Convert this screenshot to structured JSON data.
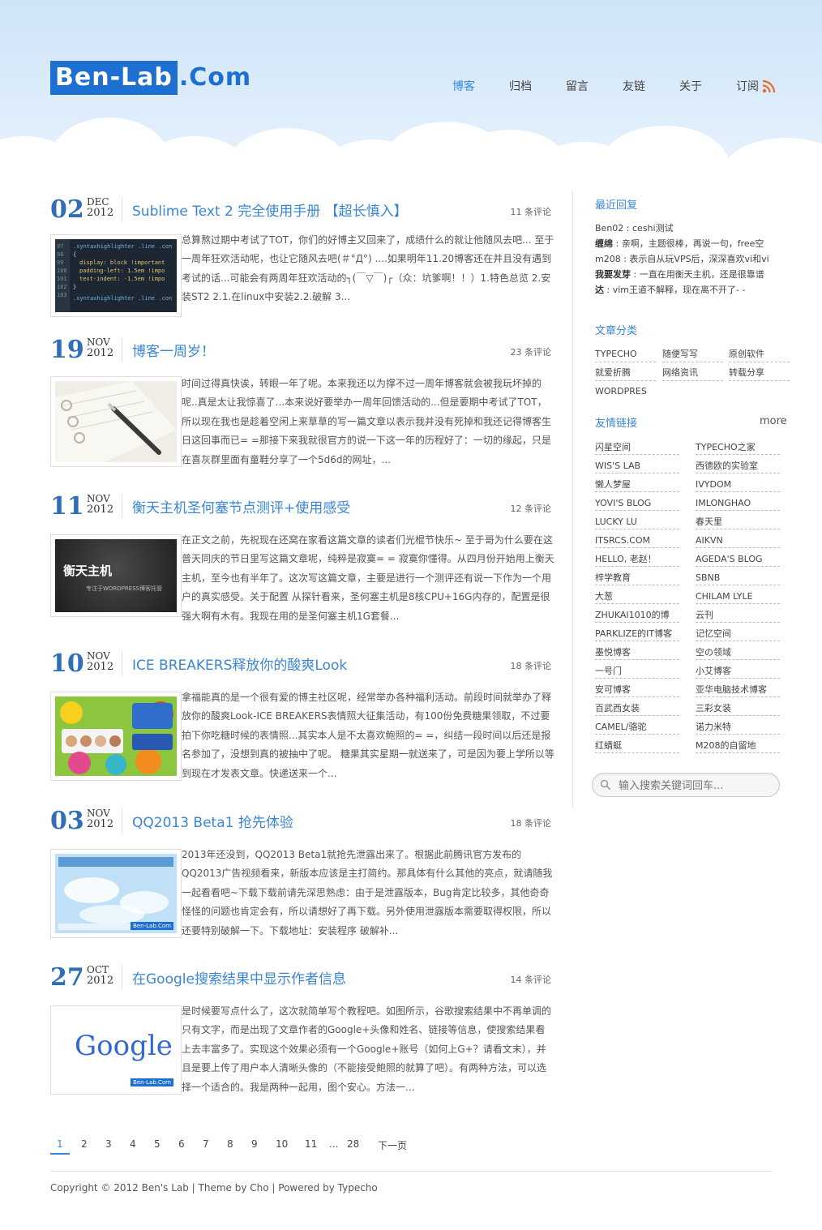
{
  "site": {
    "logo_boxed": "Ben-Lab",
    "logo_rest": ".Com"
  },
  "nav": [
    {
      "label": "博客",
      "active": true
    },
    {
      "label": "归档"
    },
    {
      "label": "留言"
    },
    {
      "label": "友链"
    },
    {
      "label": "关于"
    },
    {
      "label": "订阅"
    }
  ],
  "posts": [
    {
      "day": "02",
      "month": "DEC",
      "year": "2012",
      "title": "Sublime Text 2 完全使用手册 【超长慎入】",
      "comments": "11 条评论",
      "excerpt": "总算熬过期中考试了TOT，你们的好博主又回来了，成绩什么的就让他随风去吧... 至于一周年狂欢活动呢，也让它随风去吧(＃°Д°) ....如果明年11.20博客还在并且没有遇到考试的话...可能会有两周年狂欢活动的┐(￣▽￣)┌（众：坑爹啊！！）1.特色总览 2.安装ST2 2.1.在linux中安装2.2.破解 3...",
      "thumb": "code"
    },
    {
      "day": "19",
      "month": "NOV",
      "year": "2012",
      "title": "博客一周岁！",
      "comments": "23 条评论",
      "excerpt": "时间过得真快诶，转眼一年了呢。本来我还以为撑不过一周年博客就会被我玩坏掉的呢..真是太让我惊喜了...本来说好要举办一周年回馈活动的...但是要期中考试了TOT，所以现在我也是趁着空闲上来草草的写一篇文章以表示我并没有死掉和我还记得博客生日这回事而已= =那接下来我就很官方的说一下这一年的历程好了：一切的缘起，只是在喜灰群里面有童鞋分享了一个5d6d的网址，...",
      "thumb": "notebook"
    },
    {
      "day": "11",
      "month": "NOV",
      "year": "2012",
      "title": "衡天主机圣何塞节点测评+使用感受",
      "comments": "12 条评论",
      "excerpt": "在正文之前，先祝现在还窝在家看这篇文章的读者们光棍节快乐~ 至于哥为什么要在这普天同庆的节日里写这篇文章呢，纯粹是寂寞= = 寂寞你懂得。从四月份开始用上衡天主机，至今也有半年了。这次写这篇文章，主要是进行一个测评还有说一下作为一个用户的真实感受。关于配置 从探针看来，圣何塞主机是8核CPU+16G内存的，配置是很强大啊有木有。我现在用的是圣何塞主机1G套餐...",
      "thumb": "host",
      "thumb_title": "衡天主机",
      "thumb_sub": "专注于WORDPRESS博客托管"
    },
    {
      "day": "10",
      "month": "NOV",
      "year": "2012",
      "title": "ICE BREAKERS释放你的酸爽Look",
      "comments": "18 条评论",
      "excerpt": "拿福能真的是一个很有爱的博主社区呢，经常举办各种福利活动。前段时间就举办了释放你的酸爽Look-ICE BREAKERS表情照大征集活动，有100份免费糖果领取，不过要拍下你吃糖时候的表情照...其实本人是不太喜欢鲍照的= =，纠结一段时间以后还是报名参加了，没想到真的被抽中了呢。 糖果其实星期一就送来了，可是因为要上学所以等到现在才发表文章。快递送来一个...",
      "thumb": "candy"
    },
    {
      "day": "03",
      "month": "NOV",
      "year": "2012",
      "title": "QQ2013 Beta1 抢先体验",
      "comments": "18 条评论",
      "excerpt": "2013年还没到，QQ2013 Beta1就抢先泄露出来了。根据此前腾讯官方发布的QQ2013广告视频看来，新版本应该是主打简约。那具体有什么其他的亮点，就请随我一起看看吧~下载下载前请先深思熟虑：由于是泄露版本，Bug肯定比较多，其他奇奇怪怪的问题也肯定会有，所以请想好了再下载。另外使用泄露版本需要取得权限，所以还要特别破解一下。下载地址：安装程序 破解补...",
      "thumb": "qq",
      "thumb_badge": "Ben-Lab.Com"
    },
    {
      "day": "27",
      "month": "OCT",
      "year": "2012",
      "title": "在Google搜索结果中显示作者信息",
      "comments": "14 条评论",
      "excerpt": "是时候要写点什么了，这次就简单写个教程吧。如图所示，谷歌搜索结果中不再单调的只有文字，而是出现了文章作者的Google+头像和姓名、链接等信息，使搜索结果看上去丰富多了。实现这个效果必须有一个Google+账号（如何上G+？请看文末），并且是要上传了用户本人清晰头像的（不能接受鲍照的就算了吧）。有两种方法，可以选择一个适合的。我是两种一起用，图个安心。方法一...",
      "thumb": "google",
      "thumb_word": "Google",
      "thumb_badge": "Ben-Lab.Com"
    }
  ],
  "sidebar": {
    "recent_title": "最近回复",
    "recent": [
      {
        "author": "Ben02",
        "text": "ceshi测试"
      },
      {
        "author": "缠绵",
        "text": "亲啊，主题很棒，再说一句，free空"
      },
      {
        "author": "m208",
        "text": "表示自从玩VPS后，深深喜欢vi和vi"
      },
      {
        "author": "我要发芽",
        "text": "一直在用衡天主机，还是很靠谱"
      },
      {
        "author": "达",
        "text": "vim王道不解释，现在离不开了- -"
      }
    ],
    "cat_title": "文章分类",
    "categories": [
      "TYPECHO",
      "随便写写",
      "原创软件",
      "就爱折腾",
      "网络资讯",
      "转载分享",
      "WORDPRES"
    ],
    "links_title": "友情链接",
    "more": "more",
    "links_left": [
      "闪星空间",
      "WIS'S LAB",
      "懒人梦屋",
      "YOVI'S BLOG",
      "LUCKY LU",
      "ITSRCS.COM",
      "HELLO, 老赵！",
      "梓学教育",
      "大葱",
      "ZHUKAI1010的博",
      "PARKLIZE的IT博客",
      "墨悦博客",
      "一号门",
      "安可博客",
      "百武西女装",
      "CAMEL/骆驼",
      "红蜻蜓"
    ],
    "links_right": [
      "TYPECHO之家",
      "西德欧的实验室",
      "IVYDOM",
      "IMLONGHAO",
      "春天里",
      "AIKVN",
      "AGEDA'S BLOG",
      "SBNB",
      "CHILAM LYLE",
      "云刊",
      "记忆空间",
      "空の领域",
      "小艾博客",
      "亚华电脑技术博客",
      "三彩女装",
      "诺力米特",
      "M208的自留地"
    ],
    "search_placeholder": "输入搜索关键词回车..."
  },
  "pager": {
    "pages": [
      "1",
      "2",
      "3",
      "4",
      "5",
      "6",
      "7",
      "8",
      "9",
      "10",
      "11",
      "...",
      "28"
    ],
    "next": "下一页",
    "current": "1"
  },
  "footer": {
    "text": "Copyright © 2012 Ben's Lab | Theme by Cho | Powered by Typecho"
  },
  "colors": {
    "accent": "#3a86d4",
    "logo": "#1e6fd2",
    "rss": "#e8692c"
  }
}
